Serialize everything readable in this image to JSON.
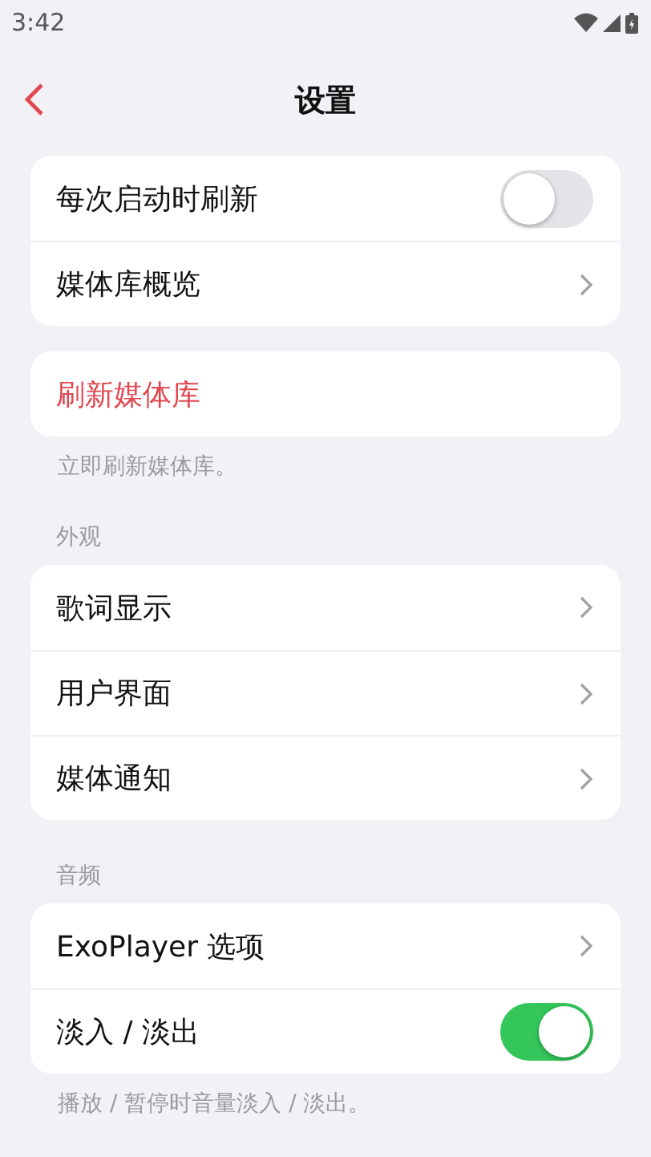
{
  "status_bar": {
    "time": "3:42"
  },
  "header": {
    "title": "设置"
  },
  "sections": [
    {
      "rows": [
        {
          "kind": "toggle",
          "label": "每次启动时刷新",
          "on": false
        },
        {
          "kind": "link",
          "label": "媒体库概览"
        }
      ]
    },
    {
      "rows": [
        {
          "kind": "action",
          "label": "刷新媒体库"
        }
      ],
      "footer": "立即刷新媒体库。"
    },
    {
      "header": "外观",
      "rows": [
        {
          "kind": "link",
          "label": "歌词显示"
        },
        {
          "kind": "link",
          "label": "用户界面"
        },
        {
          "kind": "link",
          "label": "媒体通知"
        }
      ]
    },
    {
      "header": "音频",
      "rows": [
        {
          "kind": "link",
          "label": "ExoPlayer 选项"
        },
        {
          "kind": "toggle",
          "label": "淡入 / 淡出",
          "on": true
        }
      ],
      "footer": "播放 / 暂停时音量淡入 / 淡出。"
    }
  ]
}
